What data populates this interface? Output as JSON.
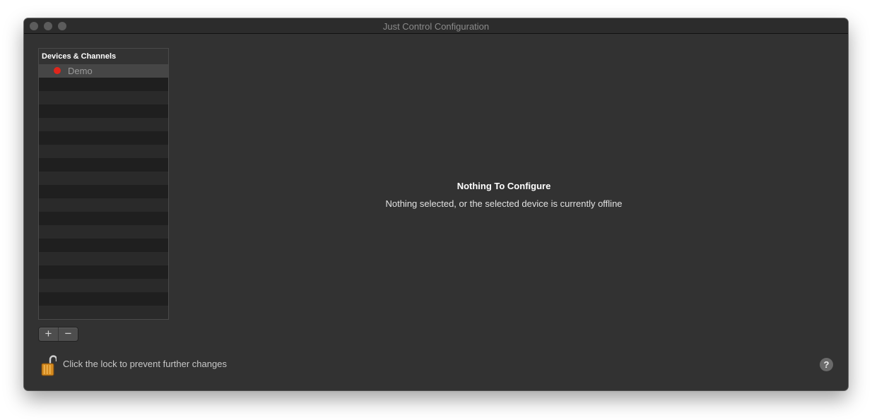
{
  "window": {
    "title": "Just Control Configuration"
  },
  "sidebar": {
    "header": "Devices & Channels",
    "items": [
      {
        "label": "Demo",
        "status": "offline",
        "status_color": "#e0261c",
        "selected": true
      }
    ]
  },
  "list_buttons": {
    "add": "+",
    "remove": "−"
  },
  "main": {
    "title": "Nothing To Configure",
    "subtitle": "Nothing selected, or the selected device is currently offline"
  },
  "footer": {
    "lock_text": "Click the lock to prevent further changes",
    "lock_icon": "unlocked-padlock-icon",
    "help_label": "?"
  },
  "colors": {
    "window_bg": "#323232",
    "status_offline": "#e0261c"
  }
}
